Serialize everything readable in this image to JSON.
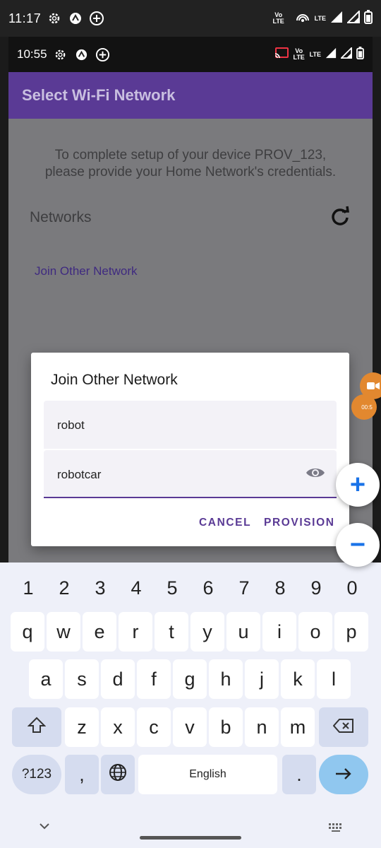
{
  "outer_status": {
    "time": "11:17",
    "volte": "Vo LTE",
    "lte": "LTE"
  },
  "inner_status": {
    "time": "10:55",
    "volte": "Vo LTE",
    "lte": "LTE"
  },
  "appbar": {
    "title": "Select Wi-Fi Network"
  },
  "main": {
    "description_line1": "To complete setup of your device PROV_123,",
    "description_line2": "please provide your Home Network's credentials.",
    "networks_label": "Networks",
    "join_other_link": "Join Other Network"
  },
  "dialog": {
    "title": "Join Other Network",
    "ssid_value": "robot",
    "password_value": "robotcar",
    "cancel_label": "CANCEL",
    "provision_label": "PROVISION"
  },
  "overlay": {
    "recording_time": "00:5",
    "zoom_in": "+",
    "zoom_out": "−"
  },
  "keyboard": {
    "numbers": [
      "1",
      "2",
      "3",
      "4",
      "5",
      "6",
      "7",
      "8",
      "9",
      "0"
    ],
    "row1": [
      "q",
      "w",
      "e",
      "r",
      "t",
      "y",
      "u",
      "i",
      "o",
      "p"
    ],
    "row2": [
      "a",
      "s",
      "d",
      "f",
      "g",
      "h",
      "j",
      "k",
      "l"
    ],
    "row3": [
      "z",
      "x",
      "c",
      "v",
      "b",
      "n",
      "m"
    ],
    "symbols_label": "?123",
    "comma": ",",
    "space_label": "English",
    "period": "."
  },
  "colors": {
    "accent": "#5a3a95",
    "appbar": "#5a3a95",
    "enter_key": "#90c7ef",
    "zoom_icon": "#1a73e8"
  }
}
